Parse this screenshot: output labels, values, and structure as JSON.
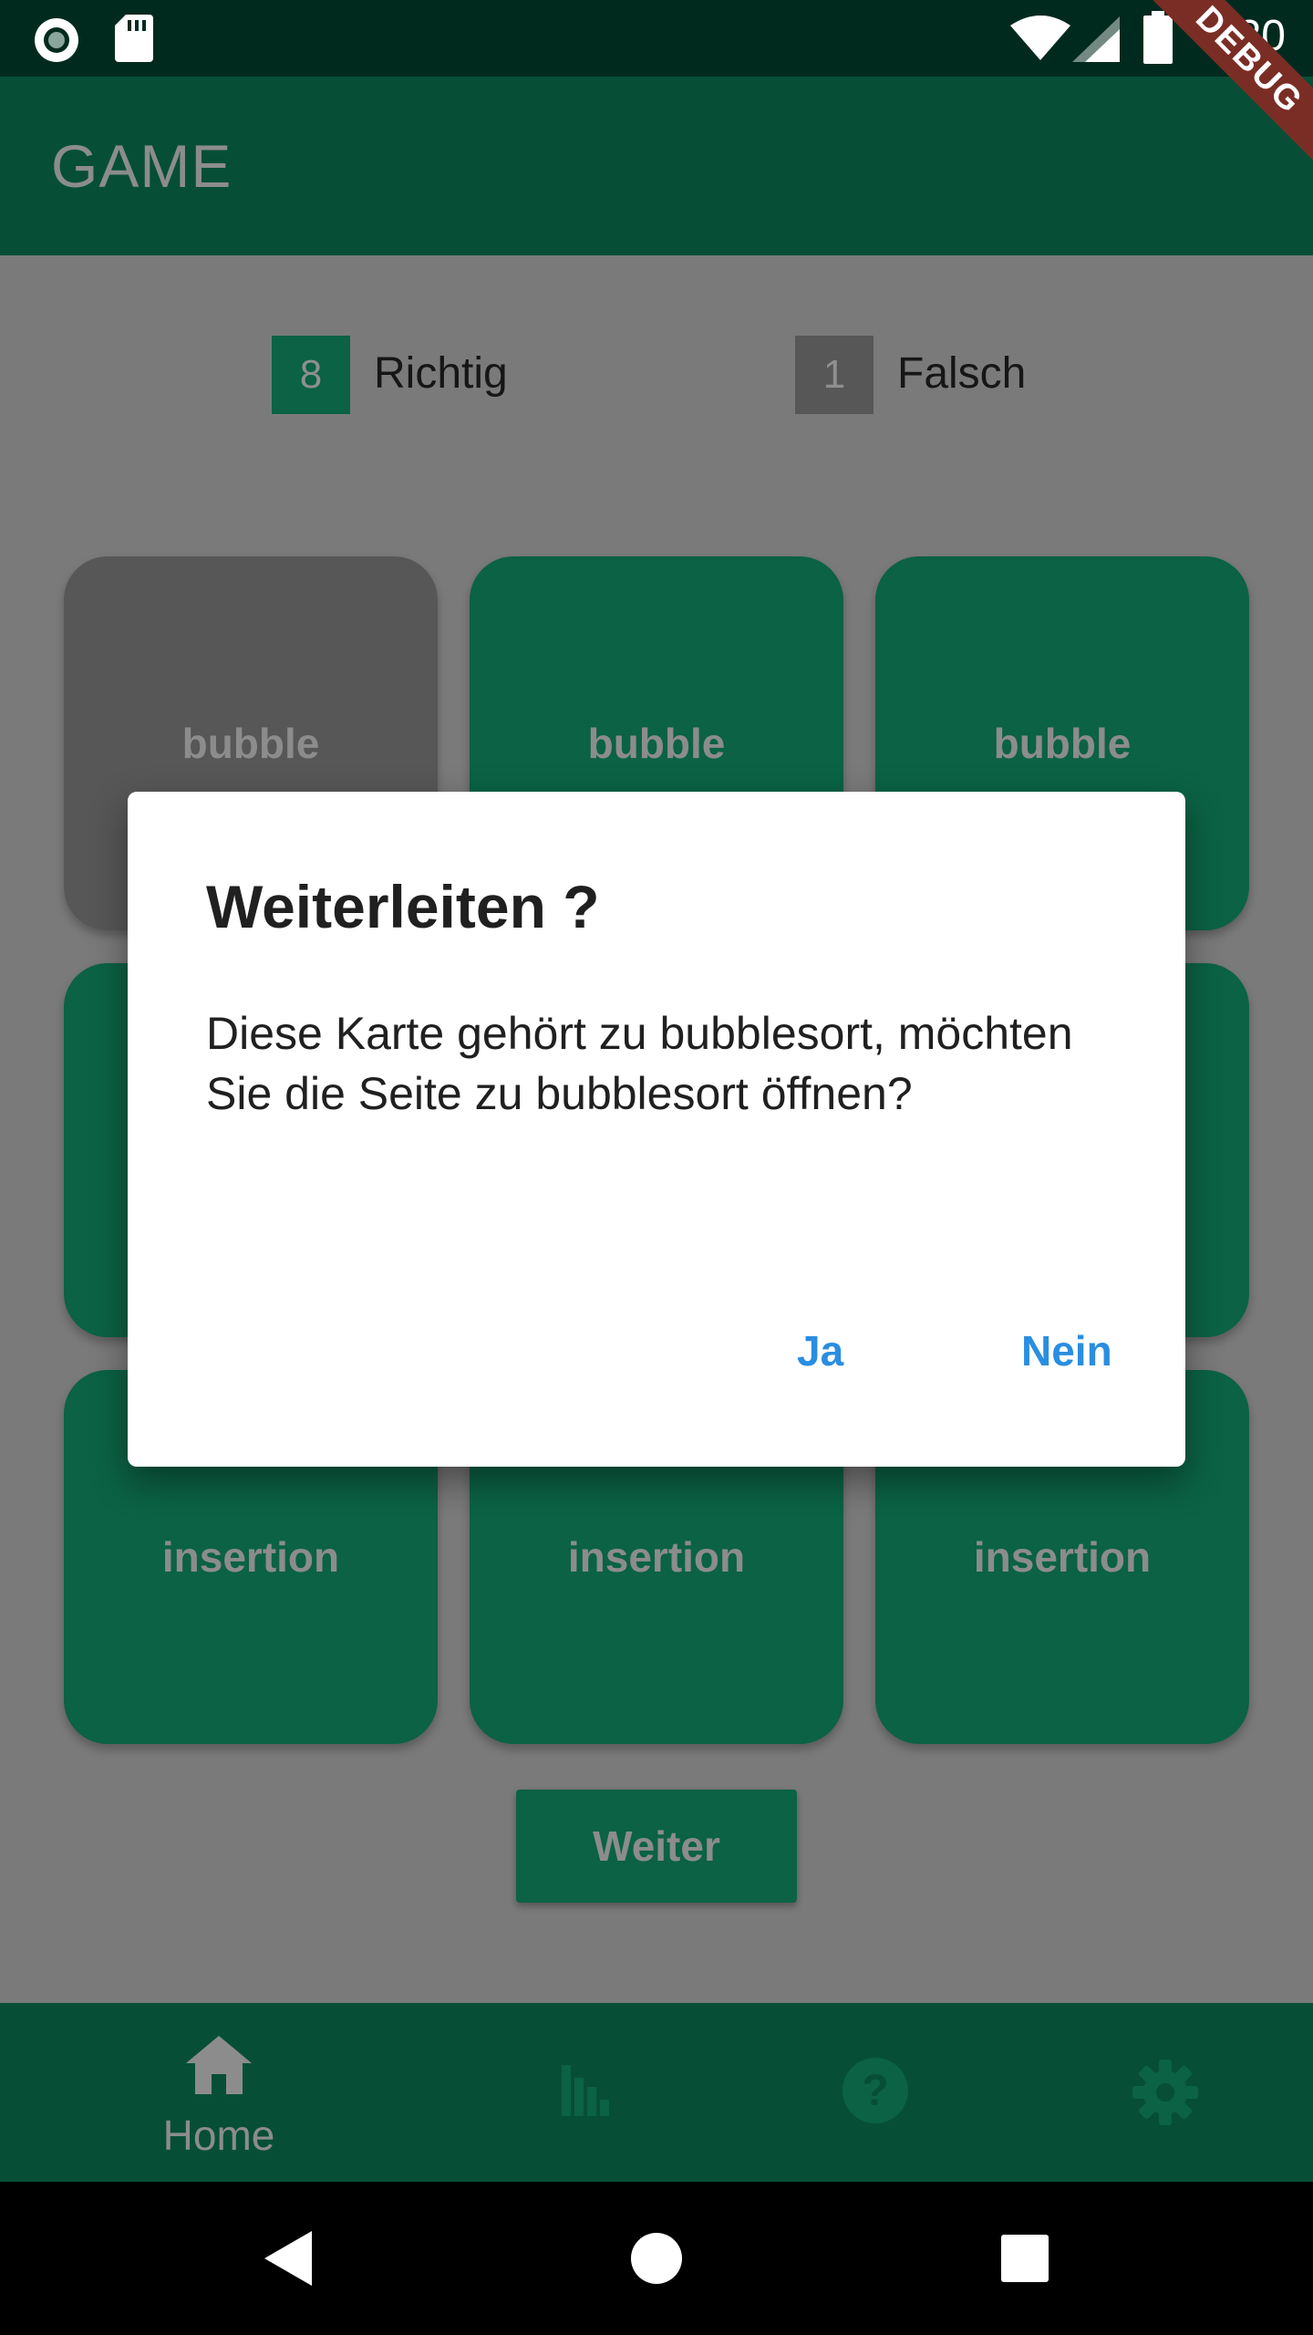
{
  "status_bar": {
    "time": "4:20",
    "icons": [
      "record-icon",
      "sd-card-icon",
      "wifi-icon",
      "signal-icon",
      "battery-icon"
    ]
  },
  "debug_banner": "DEBUG",
  "app_bar": {
    "title": "GAME"
  },
  "score": {
    "correct_count": "8",
    "correct_label": "Richtig",
    "correct_color": "#0b6244",
    "wrong_count": "1",
    "wrong_label": "Falsch",
    "wrong_color": "#575757"
  },
  "cards": [
    {
      "label": "bubble",
      "state": "wrong"
    },
    {
      "label": "bubble",
      "state": "correct"
    },
    {
      "label": "bubble",
      "state": "correct"
    },
    {
      "label": "",
      "state": "correct"
    },
    {
      "label": "",
      "state": "correct"
    },
    {
      "label": "",
      "state": "correct"
    },
    {
      "label": "insertion",
      "state": "correct"
    },
    {
      "label": "insertion",
      "state": "correct"
    },
    {
      "label": "insertion",
      "state": "correct"
    }
  ],
  "weiter_label": "Weiter",
  "bottom_nav": {
    "items": [
      {
        "label": "Home",
        "icon": "home-icon",
        "active": true
      },
      {
        "label": "",
        "icon": "stats-icon",
        "active": false
      },
      {
        "label": "",
        "icon": "help-icon",
        "active": false
      },
      {
        "label": "",
        "icon": "settings-icon",
        "active": false
      }
    ]
  },
  "dialog": {
    "title": "Weiterleiten ?",
    "message": "Diese Karte gehört zu bubblesort, möchten Sie die Seite zu bubblesort öffnen?",
    "yes_label": "Ja",
    "no_label": "Nein",
    "accent_color": "#2a8ee0"
  },
  "colors": {
    "primary": "#0b6244",
    "app_bar": "#064f36",
    "scrim_background": "#7a7a7a"
  }
}
